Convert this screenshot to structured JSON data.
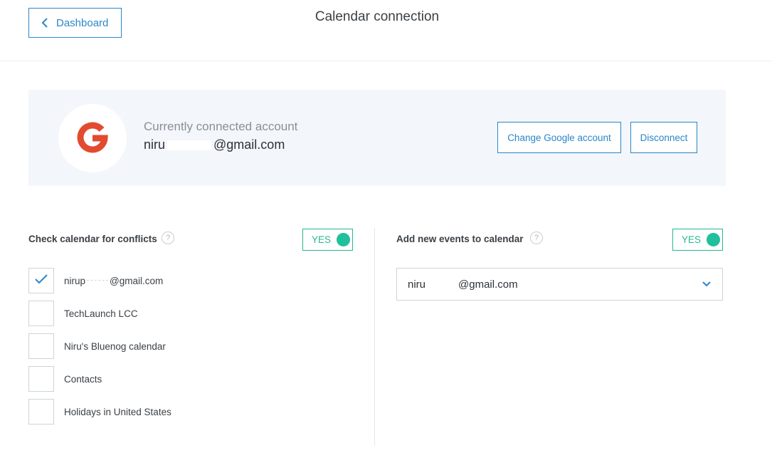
{
  "header": {
    "back_label": "Dashboard",
    "title": "Calendar connection"
  },
  "account": {
    "label": "Currently connected account",
    "email_prefix": "niru",
    "email_suffix": "@gmail.com",
    "change_button": "Change Google account",
    "disconnect_button": "Disconnect",
    "logo_icon": "google-g-icon",
    "logo_color": "#e24b2f"
  },
  "conflicts": {
    "title": "Check calendar for conflicts",
    "help": "?",
    "toggle_label": "YES",
    "toggle_on": true,
    "calendars": [
      {
        "prefix": "nirup",
        "suffix": "@gmail.com",
        "checked": true
      },
      {
        "label": "TechLaunch LCC",
        "checked": false
      },
      {
        "label": "Niru's Bluenog calendar",
        "checked": false
      },
      {
        "label": "Contacts",
        "checked": false
      },
      {
        "label": "Holidays in United States",
        "checked": false
      }
    ]
  },
  "add_events": {
    "title": "Add new events to calendar",
    "help": "?",
    "toggle_label": "YES",
    "toggle_on": true,
    "selected_prefix": "niru",
    "selected_suffix": "@gmail.com"
  },
  "colors": {
    "accent_blue": "#2b86c9",
    "toggle_green": "#25b893",
    "card_bg": "#f3f6fa"
  }
}
